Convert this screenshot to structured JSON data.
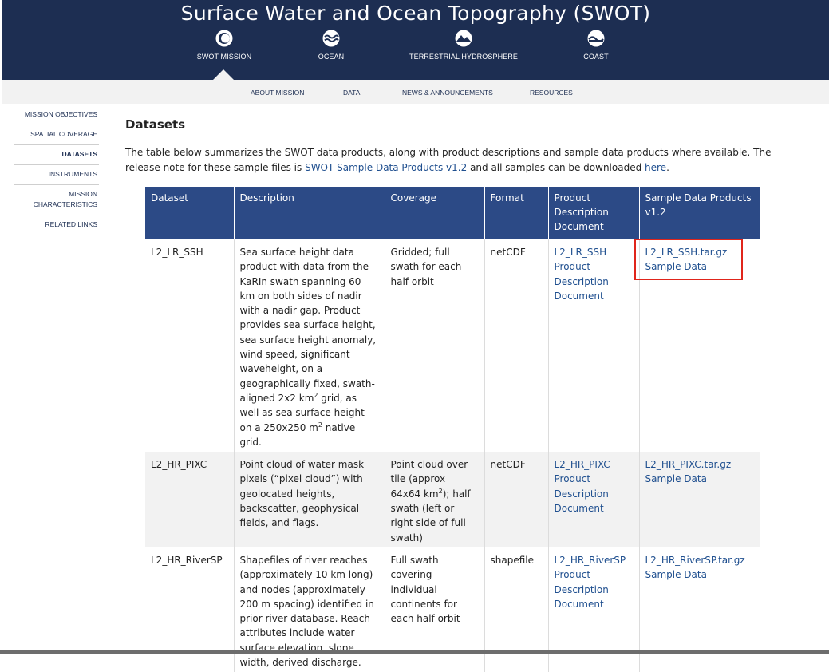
{
  "header": {
    "title": "Surface Water and Ocean Topography (SWOT)",
    "main_nav": [
      {
        "label": "SWOT MISSION",
        "icon": "swot-mission-icon",
        "active": true
      },
      {
        "label": "OCEAN",
        "icon": "ocean-icon"
      },
      {
        "label": "TERRESTRIAL HYDROSPHERE",
        "icon": "terrestrial-hydrosphere-icon"
      },
      {
        "label": "COAST",
        "icon": "coast-icon"
      }
    ]
  },
  "sub_nav": [
    "ABOUT MISSION",
    "DATA",
    "NEWS & ANNOUNCEMENTS",
    "RESOURCES"
  ],
  "side_nav": [
    "MISSION OBJECTIVES",
    "SPATIAL COVERAGE",
    "DATASETS",
    "INSTRUMENTS",
    "MISSION CHARACTERISTICS",
    "RELATED LINKS"
  ],
  "side_nav_active": "DATASETS",
  "content": {
    "heading": "Datasets",
    "intro_part1": "The table below summarizes the SWOT data products, along with product descriptions and sample data products where available. The release note for these sample files is ",
    "intro_link1": "SWOT Sample Data Products v1.2",
    "intro_part2": " and all samples can be downloaded ",
    "intro_link2": "here",
    "intro_part3": "."
  },
  "table": {
    "headers": [
      "Dataset",
      "Description",
      "Coverage",
      "Format",
      "Product Description Document",
      "Sample Data Products v1.2"
    ],
    "rows": [
      {
        "dataset": "L2_LR_SSH",
        "description_before_km2": "Sea surface height data product with data from the KaRIn swath spanning 60 km on both sides of nadir with a nadir gap. Product provides sea surface height, sea surface height anomaly, wind speed, significant waveheight, on a geographically fixed, swath-aligned 2x2 km",
        "description_mid": " grid, as well as sea surface height on a 250x250 m",
        "description_end": " native grid.",
        "coverage": "Gridded; full swath for each half orbit",
        "format": "netCDF",
        "doc_link": "L2_LR_SSH Product Description Document",
        "sample_file": "L2_LR_SSH.tar.gz",
        "sample_label": "Sample Data"
      },
      {
        "dataset": "L2_HR_PIXC",
        "description": "Point cloud of water mask pixels (“pixel cloud”) with geolocated heights, backscatter, geophysical fields, and flags.",
        "coverage_before": "Point cloud over tile (approx 64x64 km",
        "coverage_after": "); half swath (left or right side of full swath)",
        "format": "netCDF",
        "doc_link": "L2_HR_PIXC Product Description Document",
        "sample_file": "L2_HR_PIXC.tar.gz",
        "sample_label": "Sample Data"
      },
      {
        "dataset": "L2_HR_RiverSP",
        "description": "Shapefiles of river reaches (approximately 10 km long) and nodes (approximately 200 m spacing) identified in prior river database. Reach attributes include water surface elevation, slope, width, derived discharge.",
        "coverage": "Full swath covering individual continents for each half orbit",
        "format": "shapefile",
        "doc_link": "L2_HR_RiverSP Product Description Document",
        "sample_file": "L2_HR_RiverSP.tar.gz",
        "sample_label": "Sample Data"
      }
    ],
    "superscript": "2"
  },
  "colors": {
    "header_bg": "#1d2e52",
    "table_header_bg": "#2c4a86",
    "link": "#1f4f8f",
    "highlight": "#e0251b"
  }
}
